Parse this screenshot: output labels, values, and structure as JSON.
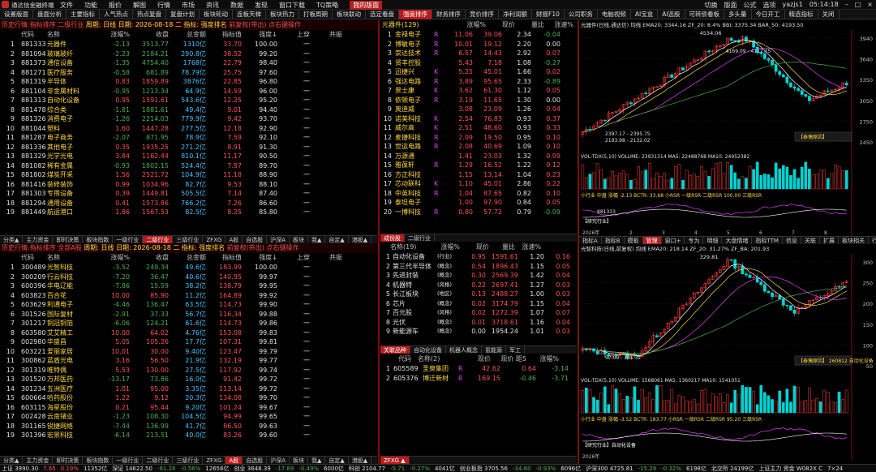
{
  "app": {
    "name": "通达信金融终端",
    "user": "yazjs1",
    "time": "05:14:18"
  },
  "menu": [
    "文件",
    "功能",
    "报价",
    "解图",
    "行情",
    "市场",
    "资讯",
    "数据",
    "发现",
    "窗口下载",
    "TQ策略",
    "我的版面"
  ],
  "title_right": [
    "切换",
    "版面",
    "公式",
    "选项"
  ],
  "top_tabs": [
    "设置版面",
    "盘面分析",
    "主要指标",
    "人气热点",
    "热点复盘",
    "复盘计划",
    "板块轮动",
    "连板天梯",
    "板块热力",
    "打板周期",
    "板块联动",
    "选定看盘",
    "强度排序",
    "财务排序",
    "竞价排序",
    "净利润额",
    "财报F10",
    "公司职务",
    "电脑视频",
    "AI宝盒",
    "AI选股",
    "可转债看板",
    "多头量",
    "今日开工",
    "精选指标",
    "关闭"
  ],
  "top_tabs_active": 12,
  "panel1": {
    "title": "历史行情:指标排序 二级行业",
    "period": "周期: 日线",
    "date": "日期: 2026-08-18 二",
    "indicator": "指标: 强度排名",
    "fq": "前复权(带出)",
    "hint": "点右键操作",
    "headers": [
      "代码",
      "名称",
      "涨幅%",
      "收盘",
      "总金额",
      "指标值",
      "强度↓",
      "上穿",
      "共振"
    ],
    "rows": [
      [
        "881333",
        "元器件",
        "-2.13",
        "3513.77",
        "1310亿",
        "33.70",
        "100.00",
        "一"
      ],
      [
        "881094",
        "玻璃玻纤",
        "-2.23",
        "2184.21",
        "290.8亿",
        "38.52",
        "99.20",
        "一"
      ],
      [
        "881373",
        "通信设备",
        "-1.35",
        "4754.40",
        "1768亿",
        "22.79",
        "98.40",
        "一"
      ],
      [
        "881271",
        "医疗服务",
        "-0.58",
        "681.89",
        "78.79亿",
        "25.75",
        "97.60",
        "一"
      ],
      [
        "881319",
        "半导体",
        "0.83",
        "1859.89",
        "3876亿",
        "22.85",
        "96.80",
        "一"
      ],
      [
        "881104",
        "非金属材料",
        "-0.95",
        "1213.34",
        "64.9亿",
        "14.59",
        "96.00",
        "一"
      ],
      [
        "881313",
        "自动化设备",
        "0.95",
        "1591.61",
        "543.6亿",
        "12.25",
        "95.20",
        "一"
      ],
      [
        "881478",
        "综合类",
        "-1.81",
        "1881.61",
        "49.4亿",
        "9.01",
        "94.40",
        "一"
      ],
      [
        "881326",
        "消费电子",
        "-1.26",
        "2214.03",
        "779.9亿",
        "9.42",
        "93.70",
        "一"
      ],
      [
        "881044",
        "塑料",
        "1.60",
        "1447.28",
        "277.5亿",
        "12.18",
        "92.90",
        "一"
      ],
      [
        "881287",
        "电子商务",
        "-2.07",
        "871.95",
        "78.9亿",
        "7.59",
        "92.10",
        "一"
      ],
      [
        "881336",
        "其他电子",
        "0.35",
        "1935.25",
        "271.2亿",
        "8.91",
        "91.30",
        "一"
      ],
      [
        "881329",
        "光学光电",
        "3.84",
        "1162.44",
        "810.1亿",
        "11.17",
        "90.50",
        "一"
      ],
      [
        "881082",
        "稀有金属",
        "-0.93",
        "1802.15",
        "524.4亿",
        "7.87",
        "89.70",
        "一"
      ],
      [
        "881802",
        "煤炭开采",
        "1.56",
        "2521.72",
        "104.9亿",
        "11.18",
        "88.90",
        "一"
      ],
      [
        "881416",
        "装修装饰",
        "0.99",
        "1034.96",
        "82.7亿",
        "9.53",
        "88.10",
        "一"
      ],
      [
        "881303",
        "专用设备",
        "0.39",
        "1449.81",
        "505.5亿",
        "7.14",
        "87.40",
        "一"
      ],
      [
        "881294",
        "通用设备",
        "0.41",
        "1573.86",
        "766.2亿",
        "7.26",
        "86.60",
        "一"
      ],
      [
        "881449",
        "航运港口",
        "1.86",
        "1567.53",
        "82.5亿",
        "8.25",
        "85.80",
        "一"
      ]
    ],
    "bottom_tabs": [
      "分类▲",
      "主力资金",
      "即时决策",
      "板块指数",
      "一级行业",
      "二级行业",
      "三级行业",
      "ZFXG",
      "A股",
      "自选股",
      "沪深A",
      "板块",
      "我▲",
      "自定▲",
      "港股▲"
    ],
    "bottom_active": 5
  },
  "panel2": {
    "title": "历史行情:指标排序 全部A股",
    "period": "周期: 日线",
    "date": "日期: 2026-08-18 二",
    "indicator": "指标: 强度排名",
    "fq": "前复权(带出)",
    "hint": "点右键操作",
    "headers": [
      "代码",
      "名称",
      "涨幅%",
      "收盘",
      "总金额",
      "指标值",
      "强度↓",
      "上穿",
      "共振"
    ],
    "rows": [
      [
        "300489",
        "光智科技",
        "-3.52",
        "249.34",
        "49.6亿",
        "183.99",
        "100.00",
        "一"
      ],
      [
        "300209",
        "行云科技",
        "-7.20",
        "36.47",
        "40.6亿",
        "140.95",
        "99.97",
        "一"
      ],
      [
        "600396",
        "华电辽能",
        "-7.86",
        "15.59",
        "38.2亿",
        "138.79",
        "99.95",
        "一"
      ],
      [
        "603823",
        "百合花",
        "10.00",
        "85.90",
        "11.2亿",
        "164.89",
        "99.92",
        "一"
      ],
      [
        "603629",
        "利通电子",
        "-4.46",
        "136.47",
        "63.5亿",
        "114.73",
        "99.90",
        "一"
      ],
      [
        "301526",
        "国际复材",
        "-2.91",
        "37.33",
        "56.7亿",
        "116.34",
        "99.88",
        "一"
      ],
      [
        "301217",
        "铜冠铜箔",
        "-6.06",
        "124.21",
        "61.6亿",
        "114.73",
        "99.86",
        "一"
      ],
      [
        "603580",
        "艾艾精工",
        "10.00",
        "64.02",
        "4.76亿",
        "153.08",
        "99.83",
        "一"
      ],
      [
        "002980",
        "华盛昌",
        "5.05",
        "105.26",
        "17.7亿",
        "107.31",
        "99.81",
        "一"
      ],
      [
        "603221",
        "爱丽家居",
        "10.01",
        "30.00",
        "9.40亿",
        "123.47",
        "99.79",
        "一"
      ],
      [
        "300862",
        "蓝盾光电",
        "3.16",
        "56.50",
        "21.9亿",
        "132.19",
        "99.77",
        "一"
      ],
      [
        "301319",
        "唯特偶",
        "5.53",
        "130.00",
        "27.5亿",
        "117.92",
        "99.74",
        "一"
      ],
      [
        "301520",
        "万邦医药",
        "-13.17",
        "73.86",
        "16.0亿",
        "91.42",
        "99.72",
        "一"
      ],
      [
        "301234",
        "五洲医疗",
        "1.01",
        "95.00",
        "3.35亿",
        "113.14",
        "99.72",
        "一"
      ],
      [
        "600664",
        "哈药股份",
        "1.22",
        "9.12",
        "20.3亿",
        "134.08",
        "99.70",
        "一"
      ],
      [
        "603115",
        "海星股份",
        "0.21",
        "95.44",
        "9.20亿",
        "101.24",
        "99.67",
        "一"
      ],
      [
        "002428",
        "云南锗业",
        "-1.23",
        "108.30",
        "104.5亿",
        "94.99",
        "99.65",
        "一"
      ],
      [
        "301165",
        "锐捷网络",
        "-7.44",
        "136.99",
        "41.7亿",
        "86.50",
        "99.63",
        "一"
      ],
      [
        "301396",
        "宏景科技",
        "-6.14",
        "213.51",
        "40.0亿",
        "83.26",
        "99.60",
        "一"
      ]
    ],
    "bottom_tabs": [
      "分类▲",
      "主力资金",
      "即时决策",
      "板块指数",
      "一级行业",
      "二级行业",
      "三级行业",
      "ZFXG",
      "A股",
      "自选股",
      "沪深A",
      "板块",
      "我▲",
      "自定▲",
      "港股▲"
    ],
    "bottom_active": 8
  },
  "mid1": {
    "header": "元器件(129)",
    "headers": [
      "",
      "",
      "涨幅%",
      "现价",
      "量比",
      "涨速%"
    ],
    "rows": [
      [
        "1",
        "金禄电子",
        "R",
        "11.06",
        "39.06",
        "2.34",
        "-0.04"
      ],
      [
        "2",
        "博敏电子",
        "R",
        "10.01",
        "19.12",
        "2.20",
        "0.00"
      ],
      [
        "3",
        "崇达技术",
        "R",
        "6.57",
        "14.43",
        "2.92",
        "0.07"
      ],
      [
        "4",
        "贤丰控股",
        "",
        "5.43",
        "7.18",
        "1.08",
        "-0.27"
      ],
      [
        "5",
        "迅捷兴",
        "K",
        "5.25",
        "45.01",
        "1.66",
        "0.02"
      ],
      [
        "6",
        "强达电路",
        "R",
        "3.89",
        "95.65",
        "2.33",
        "-0.89"
      ],
      [
        "7",
        "景士康",
        "K",
        "3.62",
        "61.30",
        "1.12",
        "0.05"
      ],
      [
        "8",
        "依顿电子",
        "R",
        "3.19",
        "11.65",
        "1.30",
        "0.00"
      ],
      [
        "9",
        "奥迪威",
        "",
        "3.08",
        "23.09",
        "1.26",
        "0.04"
      ],
      [
        "10",
        "诺美科技",
        "K",
        "2.54",
        "76.83",
        "0.93",
        "0.37"
      ],
      [
        "11",
        "威尔高",
        "K",
        "2.51",
        "48.60",
        "0.93",
        "0.33"
      ],
      [
        "12",
        "麦捷科技",
        "R",
        "2.09",
        "19.50",
        "0.95",
        "0.10"
      ],
      [
        "13",
        "世运电路",
        "R",
        "2.08",
        "40.69",
        "1.09",
        "0.10"
      ],
      [
        "14",
        "万源通",
        "",
        "1.41",
        "23.03",
        "1.32",
        "0.09"
      ],
      [
        "15",
        "雅葆轩",
        "R",
        "1.29",
        "16.52",
        "1.22",
        "0.12"
      ],
      [
        "16",
        "方正科技",
        "",
        "1.15",
        "13.14",
        "1.04",
        "0.23"
      ],
      [
        "17",
        "芯动联科",
        "K",
        "1.10",
        "45.01",
        "2.86",
        "0.22"
      ],
      [
        "18",
        "中英科技",
        "R",
        "1.04",
        "87.65",
        "0.82",
        "0.10"
      ],
      [
        "19",
        "泰坦电子",
        "",
        "1.00",
        "97.90",
        "0.84",
        "0.05"
      ],
      [
        "20",
        "一博科技",
        "R",
        "0.80",
        "57.72",
        "0.79",
        "-0.09"
      ]
    ],
    "tabs": [
      "成份股",
      "二级行业"
    ]
  },
  "mid2": {
    "headers": [
      "名称(19)",
      "涨幅%",
      "现价",
      "量比",
      "涨速%"
    ],
    "rows": [
      [
        "1",
        "自动化设备",
        "(行业)",
        "0.95",
        "1591.61",
        "1.20",
        "0.16"
      ],
      [
        "2",
        "第三代半导体",
        "(概念)",
        "0.54",
        "1896.43",
        "1.15",
        "0.05"
      ],
      [
        "3",
        "先进封装",
        "(概念)",
        "0.30",
        "2569.39",
        "1.42",
        "0.04"
      ],
      [
        "4",
        "机器特",
        "(风格)",
        "0.22",
        "2697.41",
        "1.27",
        "0.03"
      ],
      [
        "5",
        "长江板块",
        "(地区)",
        "0.13",
        "2488.27",
        "1.00",
        "0.03"
      ],
      [
        "6",
        "芯片",
        "(概念)",
        "0.02",
        "3174.79",
        "1.15",
        "0.04"
      ],
      [
        "7",
        "百元股",
        "(风格)",
        "0.02",
        "1272.39",
        "1.07",
        "0.07"
      ],
      [
        "8",
        "光伏",
        "(概念)",
        "0.01",
        "3718.61",
        "1.16",
        "0.04"
      ],
      [
        "9",
        "新能源车",
        "(概念)",
        "0.00",
        "1954.24",
        "1.01",
        "0.03"
      ]
    ],
    "tabs": [
      "关联品种",
      "自动化设备",
      "机器人概念",
      "氢能源",
      "军工"
    ],
    "sub_headers": [
      "代码",
      "名称(2)",
      "现价",
      "现价 距5日%",
      "涨幅%"
    ],
    "sub_rows": [
      [
        "1",
        "605589",
        "圣泉集团",
        "R",
        "42.62",
        "0.64",
        "-3.14"
      ],
      [
        "2",
        "605376",
        "博迁新材",
        "R",
        "169.15",
        "-0.46",
        "-3.71"
      ]
    ]
  },
  "chart1": {
    "title": "元器件(日线,通达信) 均线 EMA20: 3344.16 ZF_20: 8.4% BBI: 3375.34 BAR_50: 4193.50",
    "high_label": "4534.06",
    "mid_label": "4169.09 - 4117.75",
    "low_label1": "2397.17 - 2395.75",
    "low_label2": "2193.98 - 2132.02",
    "prices": [
      "3940",
      "3640",
      "3350",
      "3050",
      "2750",
      "2450"
    ],
    "vol_label": "VOL-TDX(5,10) VOLUME: 23931314 MA5: 22488768 MA10: 24952382",
    "rsr_label": "小行业 中盘 涨幅 -2.13 BCTR: 33.68 小RSR 一级RSR 二级RSR 100.00 三级RSR",
    "code_tag": "881333",
    "research": "【研究行业】",
    "tip": "【泰偶原因】",
    "year_label": "2026年",
    "months": [
      "2",
      "3",
      "4",
      "5",
      "6",
      "7",
      "8"
    ]
  },
  "chart2": {
    "title": "光智科技(日线,前复权) 均线 EMA20: 218.14 ZF_20: 31.27% ZF_BA: 201.93",
    "high_label": "329.81",
    "low_label1": "97.09 - 101.32",
    "prices": [
      "300",
      "250",
      "200",
      "150",
      "100",
      "50"
    ],
    "vol_label": "VOL-TDX(5,10) VOLUME: 1568061 MA5: 1360217 MA10: 1541051",
    "rsr_label": "小行业 中盘 涨幅 -3.52 BCTR: 183.77 小RSR 一级RSR 二级RSR 95.20 三级RSR",
    "research": "【研究行业】自动化设备",
    "tip": "【泰偶原因】 260812 自动化设备",
    "year_label": "2026年",
    "tabs": [
      "指标A",
      "指标B",
      "模板",
      "管理",
      "窗口+",
      "专为",
      "明细",
      "大盘情绪",
      "指标TTM",
      "信息",
      "关联",
      "扩展",
      "板块相关",
      "行业行业"
    ]
  },
  "status": {
    "items": [
      "上证 3990.30",
      "7.65",
      "0.19%",
      "11352亿",
      "深证 14622.50",
      "-81.28",
      "-0.56%",
      "12656亿",
      "创业 3648.39",
      "-17.89",
      "-0.49%",
      "6000亿",
      "科创 2104.77",
      "-5.71",
      "-0.27%",
      "4041亿",
      "创业板指 3705.56",
      "-34.60",
      "-0.93%",
      "6096亿",
      "沪深300 4725.81",
      "-15.29",
      "-0.32%",
      "6198亿",
      "北交所 24199亿",
      "上证主力 资金 W082X C",
      "7×24"
    ]
  },
  "colors": {
    "up": "#ff5252",
    "down": "#4caf50",
    "accent": "#b71c1c",
    "highlight": "#ffd740"
  }
}
